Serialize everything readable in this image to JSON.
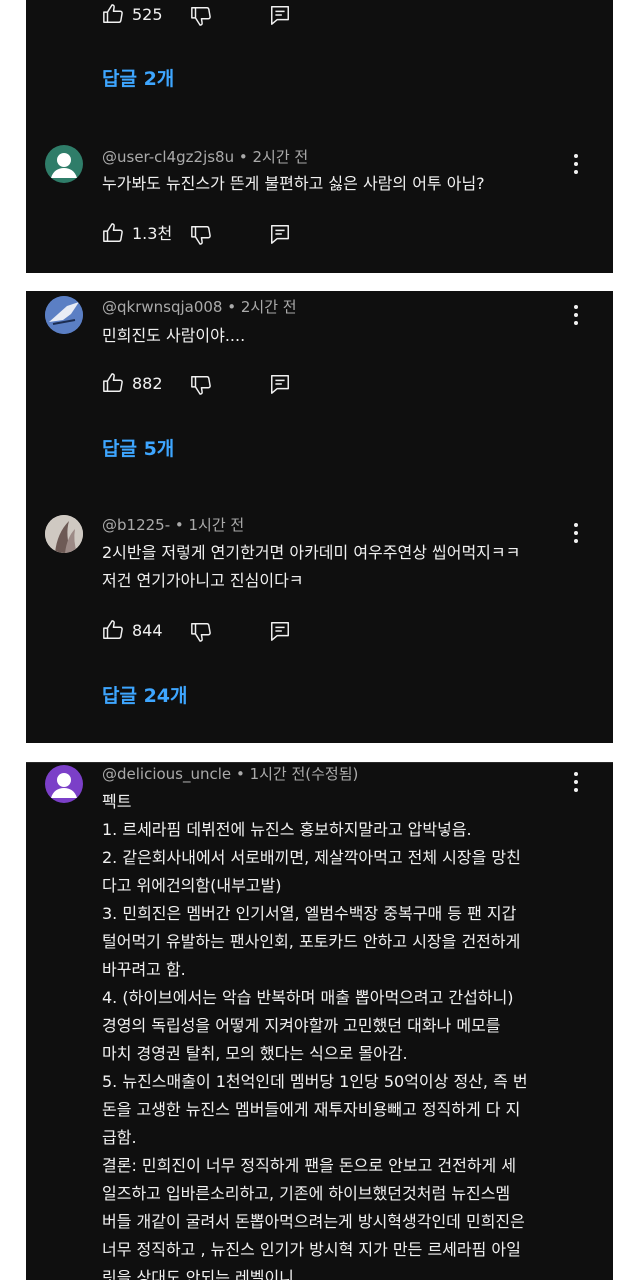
{
  "comment0": {
    "likes": "525",
    "replies_label": "답글 2개"
  },
  "comment1": {
    "author": "@user-cl4gz2js8u",
    "time": "2시간 전",
    "text": "누가봐도 뉴진스가 뜬게 불편하고 싫은 사람의 어투 아님?",
    "likes": "1.3천",
    "avatar_color": "#2f7d69"
  },
  "comment2": {
    "author": "@qkrwnsqja008",
    "time": "2시간 전",
    "text": "민희진도 사람이야....",
    "likes": "882",
    "replies_label": "답글 5개"
  },
  "comment3": {
    "author": "@b1225-",
    "time": "1시간 전",
    "lines": [
      "2시반을 저렇게 연기한거면 아카데미 여우주연상 씹어먹지ㅋㅋ",
      "저건 연기가아니고 진심이다ㅋ"
    ],
    "likes": "844",
    "replies_label": "답글 24개"
  },
  "comment4": {
    "author": "@delicious_uncle",
    "time": "1시간 전(수정됨)",
    "avatar_color": "#7b3fc8",
    "lines": [
      "펙트",
      "1. 르세라핌 데뷔전에 뉴진스 홍보하지말라고 압박넣음.",
      "2. 같은회사내에서 서로배끼면, 제살깍아먹고 전체 시장을 망친",
      "다고 위에건의함(내부고발)",
      "3. 민희진은 멤버간 인기서열, 엘범수백장 중복구매 등 팬 지갑",
      "털어먹기 유발하는 팬사인회, 포토카드 안하고 시장을 건전하게",
      "바꾸려고 함.",
      "4. (하이브에서는 악습 반복하며 매출 뽑아먹으려고 간섭하니)",
      "경영의 독립성을 어떻게 지켜야할까 고민했던 대화나 메모를",
      "마치 경영권 탈취, 모의 했다는 식으로 몰아감.",
      "5. 뉴진스매출이 1천억인데 멤버당 1인당 50억이상 정산, 즉 번",
      "돈을 고생한 뉴진스 멤버들에게  재투자비용빼고 정직하게 다 지",
      "급함.",
      "결론: 민희진이 너무 정직하게 팬을 돈으로 안보고 건전하게 세",
      "일즈하고 입바른소리하고,  기존에 하이브했던것처럼 뉴진스멤",
      "버들 개같이 굴려서 돈뽑아먹으려는게 방시혁생각인데 민희진은",
      "너무 정직하고 , 뉴진스 인기가  방시혁 지가 만든 르세라핌 아일",
      "릿을 상대도 안되는 레벨이니"
    ]
  },
  "colors": {
    "background": "#0f0f0f",
    "text": "#f1f1f1",
    "meta": "#aaaaaa",
    "link": "#3ea6ff"
  }
}
